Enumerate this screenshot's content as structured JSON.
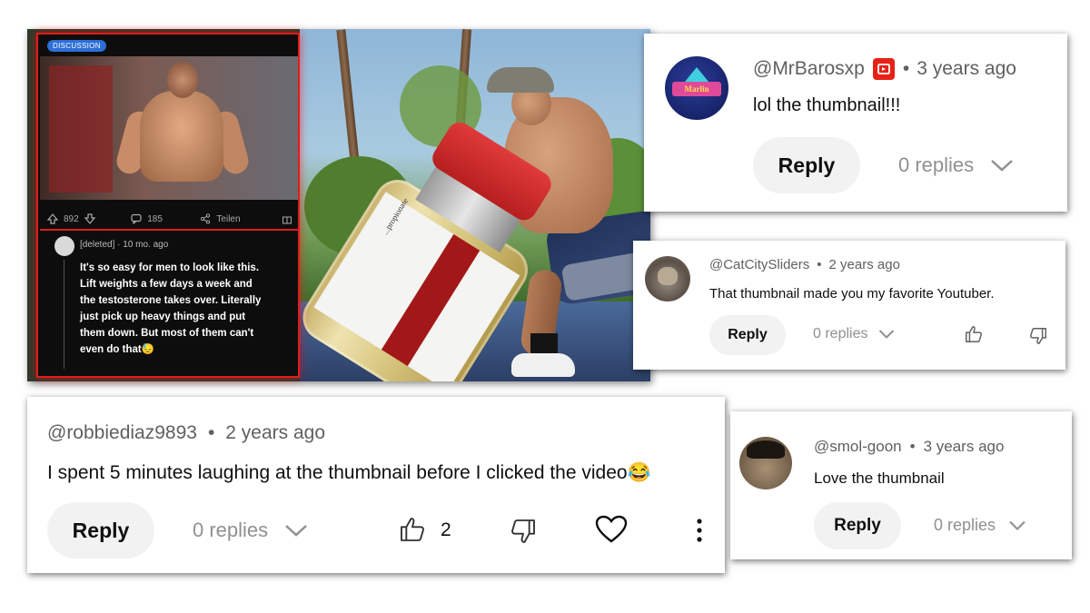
{
  "reddit_post": {
    "badge": "DISCUSSION",
    "upvotes": "892",
    "comments": "185",
    "share_label": "Teilen",
    "comment": {
      "user": "[deleted]",
      "age": "10 mo. ago",
      "text": "It's so easy for men to look like this. Lift weights a few days a week and the testosterone takes over. Literally just pick up heavy things and put them down. But most of them can't even do that😓"
    }
  },
  "vial_label": "...propionate",
  "comments": [
    {
      "handle": "@MrBarosxp",
      "age": "3 years ago",
      "text": "lol the thumbnail!!!",
      "reply_label": "Reply",
      "replies": "0 replies",
      "avatar_text": "Marlin"
    },
    {
      "handle": "@CatCitySliders",
      "age": "2 years ago",
      "text": "That thumbnail made you my favorite Youtuber.",
      "reply_label": "Reply",
      "replies": "0 replies"
    },
    {
      "handle": "@robbiediaz9893",
      "age": "2 years ago",
      "text": "I spent 5 minutes laughing at the thumbnail before I clicked the video😂",
      "reply_label": "Reply",
      "replies": "0 replies",
      "likes": "2"
    },
    {
      "handle": "@smol-goon",
      "age": "3 years ago",
      "text": "Love the thumbnail",
      "reply_label": "Reply",
      "replies": "0 replies"
    }
  ],
  "colors": {
    "reddit_border": "#e31b1b",
    "youtube_red": "#e62117",
    "reply_bg": "#f2f2f2"
  }
}
